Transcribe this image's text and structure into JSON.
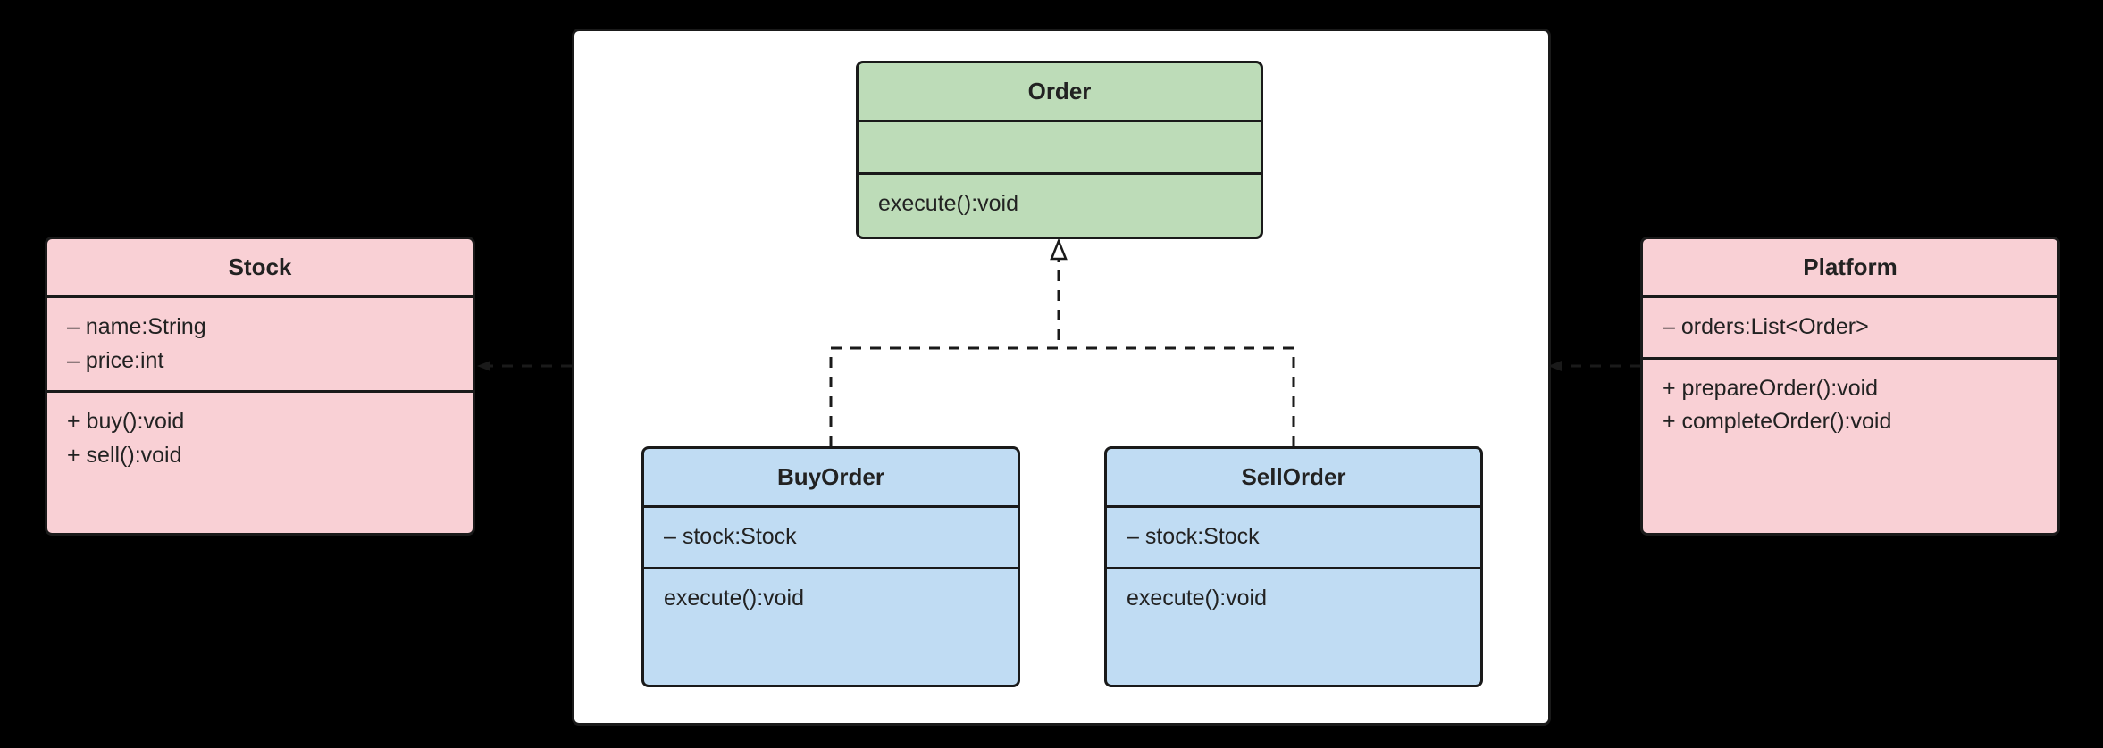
{
  "diagram": {
    "type": "uml-class",
    "classes": {
      "stock": {
        "name": "Stock",
        "attributes": [
          "– name:String",
          "– price:int"
        ],
        "operations": [
          "+ buy():void",
          "+ sell():void"
        ]
      },
      "order": {
        "name": "Order",
        "attributes": [],
        "operations": [
          "execute():void"
        ]
      },
      "buyorder": {
        "name": "BuyOrder",
        "attributes": [
          "– stock:Stock"
        ],
        "operations": [
          "execute():void"
        ]
      },
      "sellorder": {
        "name": "SellOrder",
        "attributes": [
          "– stock:Stock"
        ],
        "operations": [
          "execute():void"
        ]
      },
      "platform": {
        "name": "Platform",
        "attributes": [
          "– orders:List<Order>"
        ],
        "operations": [
          "+ prepareOrder():void",
          "+ completeOrder():void"
        ]
      }
    },
    "relations": [
      {
        "from": "buyorder",
        "to": "order",
        "kind": "realization"
      },
      {
        "from": "sellorder",
        "to": "order",
        "kind": "realization"
      },
      {
        "from": "panel",
        "to": "stock",
        "kind": "dependency"
      },
      {
        "from": "platform",
        "to": "panel",
        "kind": "dependency"
      }
    ]
  }
}
